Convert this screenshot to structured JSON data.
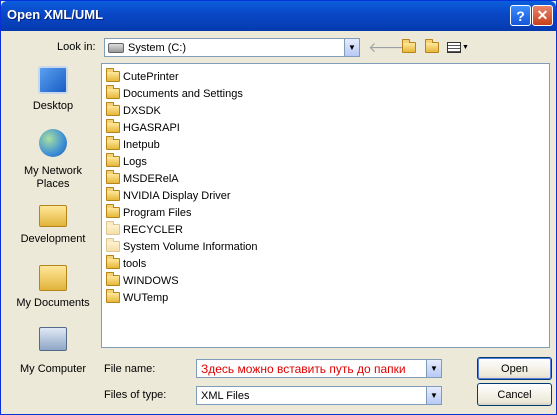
{
  "window": {
    "title": "Open XML/UML"
  },
  "titlebar": {
    "help_label": "?",
    "close_label": "✕"
  },
  "lookin": {
    "label": "Look in:",
    "value": "System (C:)"
  },
  "places": [
    {
      "label": "Desktop",
      "icon": "desktop-icon"
    },
    {
      "label": "My Network Places",
      "icon": "network-icon"
    },
    {
      "label": "Development",
      "icon": "folder-icon"
    },
    {
      "label": "My Documents",
      "icon": "documents-icon"
    },
    {
      "label": "My Computer",
      "icon": "computer-icon"
    }
  ],
  "files": [
    {
      "name": "CutePrinter",
      "hidden": false
    },
    {
      "name": "Documents and Settings",
      "hidden": false
    },
    {
      "name": "DXSDK",
      "hidden": false
    },
    {
      "name": "HGASRAPI",
      "hidden": false
    },
    {
      "name": "Inetpub",
      "hidden": false
    },
    {
      "name": "Logs",
      "hidden": false
    },
    {
      "name": "MSDERelA",
      "hidden": false
    },
    {
      "name": "NVIDIA Display Driver",
      "hidden": false
    },
    {
      "name": "Program Files",
      "hidden": false
    },
    {
      "name": "RECYCLER",
      "hidden": true
    },
    {
      "name": "System Volume Information",
      "hidden": true
    },
    {
      "name": "tools",
      "hidden": false
    },
    {
      "name": "WINDOWS",
      "hidden": false
    },
    {
      "name": "WUTemp",
      "hidden": false
    }
  ],
  "filename": {
    "label": "File name:",
    "value": "Здесь можно вставить путь до папки"
  },
  "filetype": {
    "label": "Files of type:",
    "value": "XML Files"
  },
  "buttons": {
    "open": "Open",
    "cancel": "Cancel"
  },
  "colors": {
    "title_bar": "#0a48c8",
    "input_text": "#e00000"
  }
}
